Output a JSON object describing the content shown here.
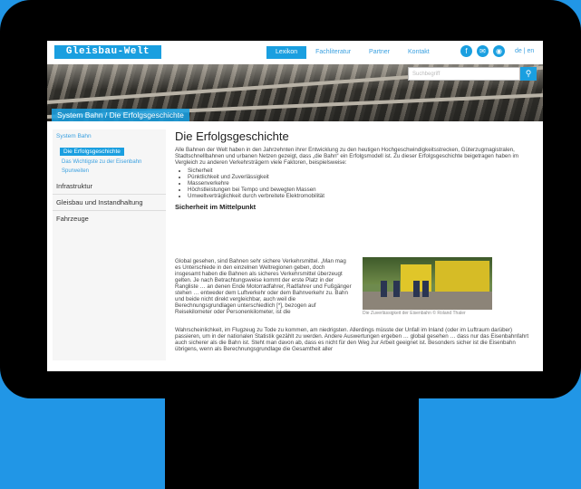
{
  "header": {
    "logo": "Gleisbau-Welt",
    "nav": [
      "Lexikon",
      "Fachliteratur",
      "Partner",
      "Kontakt"
    ],
    "active_nav": "Lexikon",
    "lang": "de | en",
    "search_placeholder": "Suchbegriff"
  },
  "banner": {
    "title": "System Bahn / Die Erfolgsgeschichte"
  },
  "sidebar": {
    "section": "System Bahn",
    "active_item": "Die Erfolgsgeschichte",
    "sub_items": [
      "Das Wichtigste zu der Eisenbahn",
      "Spurweiten"
    ],
    "main_items": [
      "Infrastruktur",
      "Gleisbau und Instandhaltung",
      "Fahrzeuge"
    ]
  },
  "article": {
    "title": "Die Erfolgsgeschichte",
    "intro": "Alle Bahnen der Welt haben in den Jahrzehnten ihrer Entwicklung zu den heutigen Hochgeschwindigkeitsstrecken, Güterzugmagistralen, Stadtschnellbahnen und urbanen Netzen gezeigt, dass „die Bahn“ ein Erfolgsmodell ist. Zu dieser Erfolgsgeschichte beigetragen haben im Vergleich zu anderen Verkehrsträgern viele Faktoren, beispielsweise:",
    "bullets": [
      "Sicherheit",
      "Pünktlichkeit und Zuverlässigkeit",
      "Massenverkehre",
      "Höchstleistungen bei Tempo und bewegten Massen",
      "Umweltverträglichkeit durch verbreitete Elektromobilität"
    ],
    "subheading": "Sicherheit im Mittelpunkt",
    "para_left": "Global gesehen, sind Bahnen sehr sichere Verkehrsmittel. „Man mag es Unterschiede in den einzelnen Weltregionen geben, doch insgesamt haben die Bahnen als sicheres Verkehrsmittel überzeugt gelten. Je nach Betrachtungsweise kommt der erste Platz in der Rangliste … an denen Ende Motorradfahrer, Radfahrer und Fußgänger stehen … entweder dem Luftverkehr oder dem Bahnverkehr zu. Bahn und beide nicht direkt vergleichbar, auch weil die Berechnungsgrundlagen unterschiedlich [*], bezogen auf Reisekilometer oder Personenkilometer, ist die",
    "para_full": "Wahrscheinlichkeit, im Flugzeug zu Tode zu kommen, am niedrigsten. Allerdings müsste der Unfall im Inland (oder im Luftraum darüber) passieren, um in der nationalen Statistik gezählt zu werden. Andere Auswertungen ergeben … global gesehen … dass nur das Eisenbahnfahrt auch sicherer als die Bahn ist. Steht man davon ab, dass es nicht für den Weg zur Arbeit geeignet ist. Besonders sicher ist die Eisenbahn übrigens, wenn als Berechnungsgrundlage die Gesamtheit aller",
    "photo_caption": "Die Zuverlässigkeit der Eisenbahn © Roland Thaler"
  }
}
